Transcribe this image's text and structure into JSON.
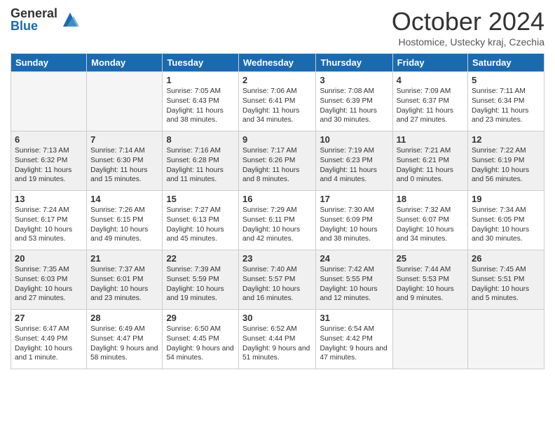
{
  "logo": {
    "general": "General",
    "blue": "Blue"
  },
  "header": {
    "month": "October 2024",
    "location": "Hostomice, Ustecky kraj, Czechia"
  },
  "days": [
    "Sunday",
    "Monday",
    "Tuesday",
    "Wednesday",
    "Thursday",
    "Friday",
    "Saturday"
  ],
  "weeks": [
    [
      {
        "day": "",
        "empty": true
      },
      {
        "day": "",
        "empty": true
      },
      {
        "day": "1",
        "sunrise": "Sunrise: 7:05 AM",
        "sunset": "Sunset: 6:43 PM",
        "daylight": "Daylight: 11 hours and 38 minutes."
      },
      {
        "day": "2",
        "sunrise": "Sunrise: 7:06 AM",
        "sunset": "Sunset: 6:41 PM",
        "daylight": "Daylight: 11 hours and 34 minutes."
      },
      {
        "day": "3",
        "sunrise": "Sunrise: 7:08 AM",
        "sunset": "Sunset: 6:39 PM",
        "daylight": "Daylight: 11 hours and 30 minutes."
      },
      {
        "day": "4",
        "sunrise": "Sunrise: 7:09 AM",
        "sunset": "Sunset: 6:37 PM",
        "daylight": "Daylight: 11 hours and 27 minutes."
      },
      {
        "day": "5",
        "sunrise": "Sunrise: 7:11 AM",
        "sunset": "Sunset: 6:34 PM",
        "daylight": "Daylight: 11 hours and 23 minutes."
      }
    ],
    [
      {
        "day": "6",
        "sunrise": "Sunrise: 7:13 AM",
        "sunset": "Sunset: 6:32 PM",
        "daylight": "Daylight: 11 hours and 19 minutes."
      },
      {
        "day": "7",
        "sunrise": "Sunrise: 7:14 AM",
        "sunset": "Sunset: 6:30 PM",
        "daylight": "Daylight: 11 hours and 15 minutes."
      },
      {
        "day": "8",
        "sunrise": "Sunrise: 7:16 AM",
        "sunset": "Sunset: 6:28 PM",
        "daylight": "Daylight: 11 hours and 11 minutes."
      },
      {
        "day": "9",
        "sunrise": "Sunrise: 7:17 AM",
        "sunset": "Sunset: 6:26 PM",
        "daylight": "Daylight: 11 hours and 8 minutes."
      },
      {
        "day": "10",
        "sunrise": "Sunrise: 7:19 AM",
        "sunset": "Sunset: 6:23 PM",
        "daylight": "Daylight: 11 hours and 4 minutes."
      },
      {
        "day": "11",
        "sunrise": "Sunrise: 7:21 AM",
        "sunset": "Sunset: 6:21 PM",
        "daylight": "Daylight: 11 hours and 0 minutes."
      },
      {
        "day": "12",
        "sunrise": "Sunrise: 7:22 AM",
        "sunset": "Sunset: 6:19 PM",
        "daylight": "Daylight: 10 hours and 56 minutes."
      }
    ],
    [
      {
        "day": "13",
        "sunrise": "Sunrise: 7:24 AM",
        "sunset": "Sunset: 6:17 PM",
        "daylight": "Daylight: 10 hours and 53 minutes."
      },
      {
        "day": "14",
        "sunrise": "Sunrise: 7:26 AM",
        "sunset": "Sunset: 6:15 PM",
        "daylight": "Daylight: 10 hours and 49 minutes."
      },
      {
        "day": "15",
        "sunrise": "Sunrise: 7:27 AM",
        "sunset": "Sunset: 6:13 PM",
        "daylight": "Daylight: 10 hours and 45 minutes."
      },
      {
        "day": "16",
        "sunrise": "Sunrise: 7:29 AM",
        "sunset": "Sunset: 6:11 PM",
        "daylight": "Daylight: 10 hours and 42 minutes."
      },
      {
        "day": "17",
        "sunrise": "Sunrise: 7:30 AM",
        "sunset": "Sunset: 6:09 PM",
        "daylight": "Daylight: 10 hours and 38 minutes."
      },
      {
        "day": "18",
        "sunrise": "Sunrise: 7:32 AM",
        "sunset": "Sunset: 6:07 PM",
        "daylight": "Daylight: 10 hours and 34 minutes."
      },
      {
        "day": "19",
        "sunrise": "Sunrise: 7:34 AM",
        "sunset": "Sunset: 6:05 PM",
        "daylight": "Daylight: 10 hours and 30 minutes."
      }
    ],
    [
      {
        "day": "20",
        "sunrise": "Sunrise: 7:35 AM",
        "sunset": "Sunset: 6:03 PM",
        "daylight": "Daylight: 10 hours and 27 minutes."
      },
      {
        "day": "21",
        "sunrise": "Sunrise: 7:37 AM",
        "sunset": "Sunset: 6:01 PM",
        "daylight": "Daylight: 10 hours and 23 minutes."
      },
      {
        "day": "22",
        "sunrise": "Sunrise: 7:39 AM",
        "sunset": "Sunset: 5:59 PM",
        "daylight": "Daylight: 10 hours and 19 minutes."
      },
      {
        "day": "23",
        "sunrise": "Sunrise: 7:40 AM",
        "sunset": "Sunset: 5:57 PM",
        "daylight": "Daylight: 10 hours and 16 minutes."
      },
      {
        "day": "24",
        "sunrise": "Sunrise: 7:42 AM",
        "sunset": "Sunset: 5:55 PM",
        "daylight": "Daylight: 10 hours and 12 minutes."
      },
      {
        "day": "25",
        "sunrise": "Sunrise: 7:44 AM",
        "sunset": "Sunset: 5:53 PM",
        "daylight": "Daylight: 10 hours and 9 minutes."
      },
      {
        "day": "26",
        "sunrise": "Sunrise: 7:45 AM",
        "sunset": "Sunset: 5:51 PM",
        "daylight": "Daylight: 10 hours and 5 minutes."
      }
    ],
    [
      {
        "day": "27",
        "sunrise": "Sunrise: 6:47 AM",
        "sunset": "Sunset: 4:49 PM",
        "daylight": "Daylight: 10 hours and 1 minute."
      },
      {
        "day": "28",
        "sunrise": "Sunrise: 6:49 AM",
        "sunset": "Sunset: 4:47 PM",
        "daylight": "Daylight: 9 hours and 58 minutes."
      },
      {
        "day": "29",
        "sunrise": "Sunrise: 6:50 AM",
        "sunset": "Sunset: 4:45 PM",
        "daylight": "Daylight: 9 hours and 54 minutes."
      },
      {
        "day": "30",
        "sunrise": "Sunrise: 6:52 AM",
        "sunset": "Sunset: 4:44 PM",
        "daylight": "Daylight: 9 hours and 51 minutes."
      },
      {
        "day": "31",
        "sunrise": "Sunrise: 6:54 AM",
        "sunset": "Sunset: 4:42 PM",
        "daylight": "Daylight: 9 hours and 47 minutes."
      },
      {
        "day": "",
        "empty": true
      },
      {
        "day": "",
        "empty": true
      }
    ]
  ]
}
